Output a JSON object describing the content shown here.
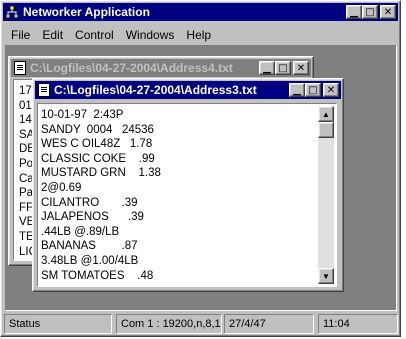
{
  "app": {
    "title": "Networker Application",
    "controls": [
      "minimize",
      "maximize",
      "close"
    ]
  },
  "menu": [
    "File",
    "Edit",
    "Control",
    "Windows",
    "Help"
  ],
  "back_window": {
    "title": "C:\\Logfiles\\04-27-2004\\Address4.txt",
    "lines": [
      "17",
      "01",
      "14",
      "SA",
      "DE",
      "Po",
      "Ca",
      "Pa",
      "FF",
      "VE",
      "TE",
      "LIC"
    ]
  },
  "front_window": {
    "title": "C:\\Logfiles\\04-27-2004\\Address3.txt",
    "lines": [
      "10-01-97  2:43P",
      "SANDY  0004   24536",
      "WES C OIL48Z   1.78",
      "CLASSIC COKE    .99",
      "MUSTARD GRN    1.38",
      "2@0.69",
      "CILANTRO       .39",
      "JALAPENOS      .39",
      ".44LB @.89/LB",
      "BANANAS        .87",
      "3.48LB @1.00/4LB",
      "SM TOMATOES    .48"
    ]
  },
  "status": {
    "state": "Status",
    "port": "Com 1 : 19200,n,8,1",
    "date": "27/4/47",
    "time": "11:04"
  },
  "colors": {
    "titlebar_active": "#000080",
    "titlebar_inactive": "#808080",
    "face": "#c0c0c0",
    "workspace": "#808080"
  }
}
